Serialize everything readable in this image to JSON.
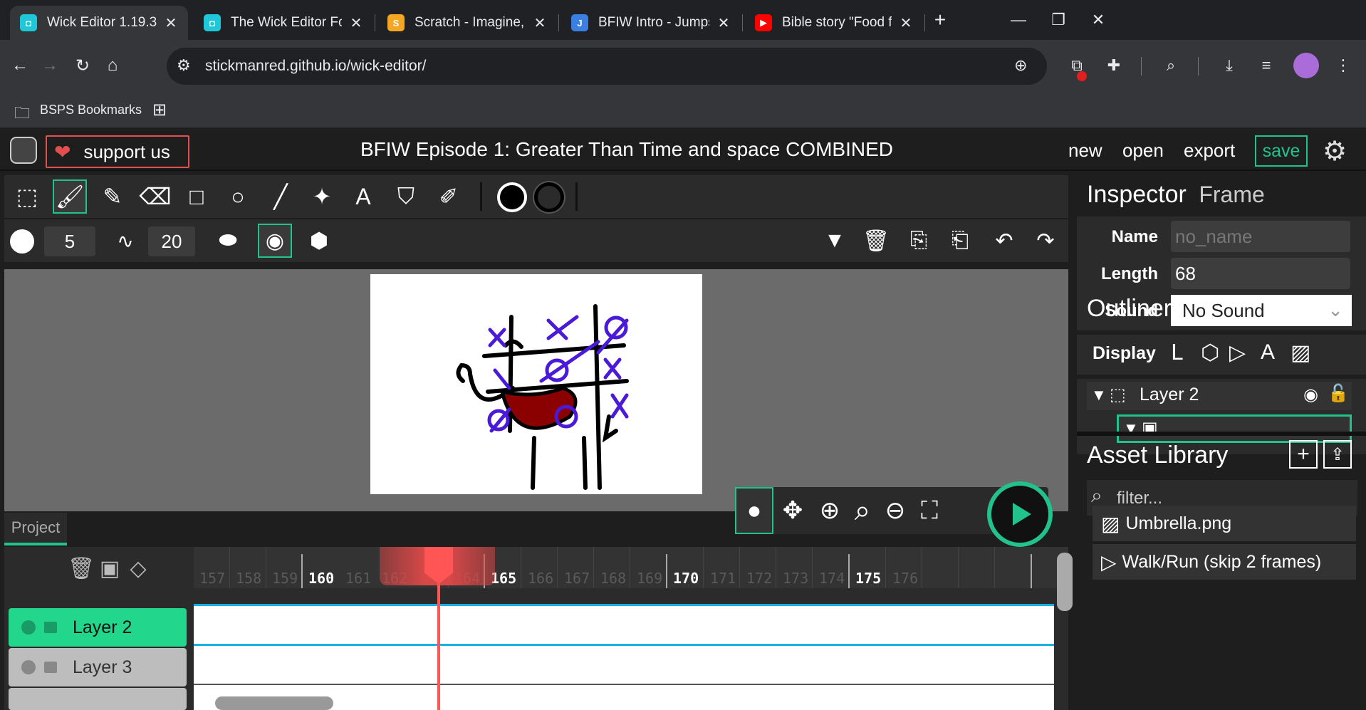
{
  "browser": {
    "tabs": [
      {
        "title": "Wick Editor 1.19.3",
        "fav_color": "#1ec8d8",
        "active": true
      },
      {
        "title": "The Wick Editor Forums",
        "fav_color": "#1ec8d8",
        "active": false
      },
      {
        "title": "Scratch - Imagine, Program",
        "fav_color": "#f5a623",
        "active": false
      },
      {
        "title": "BFIW Intro - Jumpshare",
        "fav_color": "#3b7fe0",
        "active": false
      },
      {
        "title": "Bible story \"Food for One",
        "fav_color": "#ff0000",
        "active": false
      }
    ],
    "url": "stickmanred.github.io/wick-editor/",
    "bookmarks_label": "BSPS Bookmarks"
  },
  "editor": {
    "support_label": "support us",
    "project_title": "BFIW Episode 1: Greater Than Time and space COMBINED",
    "menu": {
      "new": "new",
      "open": "open",
      "export": "export",
      "save": "save"
    },
    "brush_size": "5",
    "brush_smoothing": "20",
    "accent_color": "#22c28c",
    "project_tab": "Project",
    "timeline": {
      "ticks": [
        "157",
        "158",
        "159",
        "160",
        "161",
        "162",
        "163",
        "164",
        "165",
        "166",
        "167",
        "168",
        "169",
        "170",
        "171",
        "172",
        "173",
        "174",
        "175",
        "176"
      ],
      "layers": [
        {
          "name": "Layer 2",
          "active": true
        },
        {
          "name": "Layer 3",
          "active": false
        }
      ]
    },
    "inspector": {
      "title": "Inspector",
      "subtitle": "Frame",
      "name_label": "Name",
      "name_placeholder": "no_name",
      "length_label": "Length",
      "length_value": "68",
      "sound_label": "Sound",
      "sound_value": "No Sound"
    },
    "outliner": {
      "title": "Outliner",
      "display_label": "Display",
      "layer_name": "Layer 2"
    },
    "assets": {
      "title": "Asset Library",
      "filter_placeholder": "filter...",
      "items": [
        "Umbrella.png",
        "Walk/Run (skip 2 frames)"
      ]
    }
  }
}
